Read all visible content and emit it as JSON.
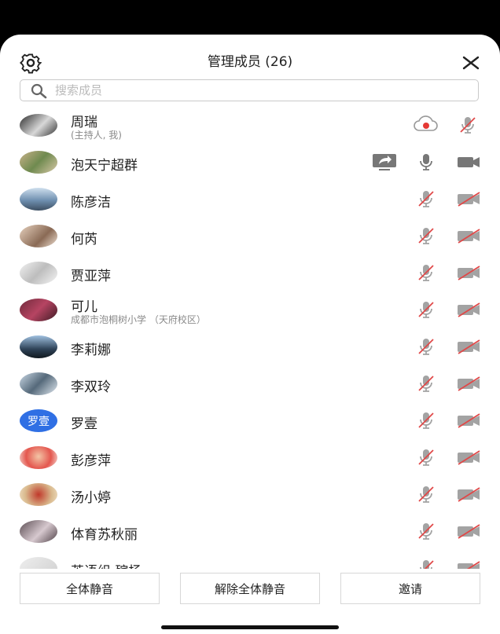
{
  "header": {
    "title": "管理成员 (26)"
  },
  "search": {
    "placeholder": "搜索成员",
    "value": ""
  },
  "colors": {
    "avatar_blue": "#2f6fe4",
    "muted_icon": "#9a9a9a",
    "muted_slash": "#e04848",
    "record_red": "#e53935"
  },
  "members": [
    {
      "name": "周瑞",
      "sub": "(主持人, 我)",
      "avatar_icon": "photo-avatar",
      "status": "host"
    },
    {
      "name": "泡天宁超群",
      "sub": "",
      "avatar_icon": "photo-avatar",
      "status": "sharing"
    },
    {
      "name": "陈彦洁",
      "sub": "",
      "avatar_icon": "photo-avatar",
      "status": "muted"
    },
    {
      "name": "何芮",
      "sub": "",
      "avatar_icon": "photo-avatar",
      "status": "muted"
    },
    {
      "name": "贾亚萍",
      "sub": "",
      "avatar_icon": "photo-avatar",
      "status": "muted"
    },
    {
      "name": "可儿",
      "sub": "成都市泡桐树小学 （天府校区）",
      "avatar_icon": "photo-avatar",
      "status": "muted"
    },
    {
      "name": "李莉娜",
      "sub": "",
      "avatar_icon": "photo-avatar",
      "status": "muted"
    },
    {
      "name": "李双玲",
      "sub": "",
      "avatar_icon": "photo-avatar",
      "status": "muted"
    },
    {
      "name": "罗壹",
      "sub": "",
      "avatar_text": "罗壹",
      "status": "muted"
    },
    {
      "name": "彭彦萍",
      "sub": "",
      "avatar_icon": "photo-avatar",
      "status": "muted"
    },
    {
      "name": "汤小婷",
      "sub": "",
      "avatar_icon": "photo-avatar",
      "status": "muted"
    },
    {
      "name": "体育苏秋丽",
      "sub": "",
      "avatar_icon": "photo-avatar",
      "status": "muted"
    },
    {
      "name": "英语组 殡杨",
      "sub": "",
      "avatar_icon": "default-avatar",
      "status": "muted"
    }
  ],
  "footer": {
    "mute_all": "全体静音",
    "unmute_all": "解除全体静音",
    "invite": "邀请"
  }
}
